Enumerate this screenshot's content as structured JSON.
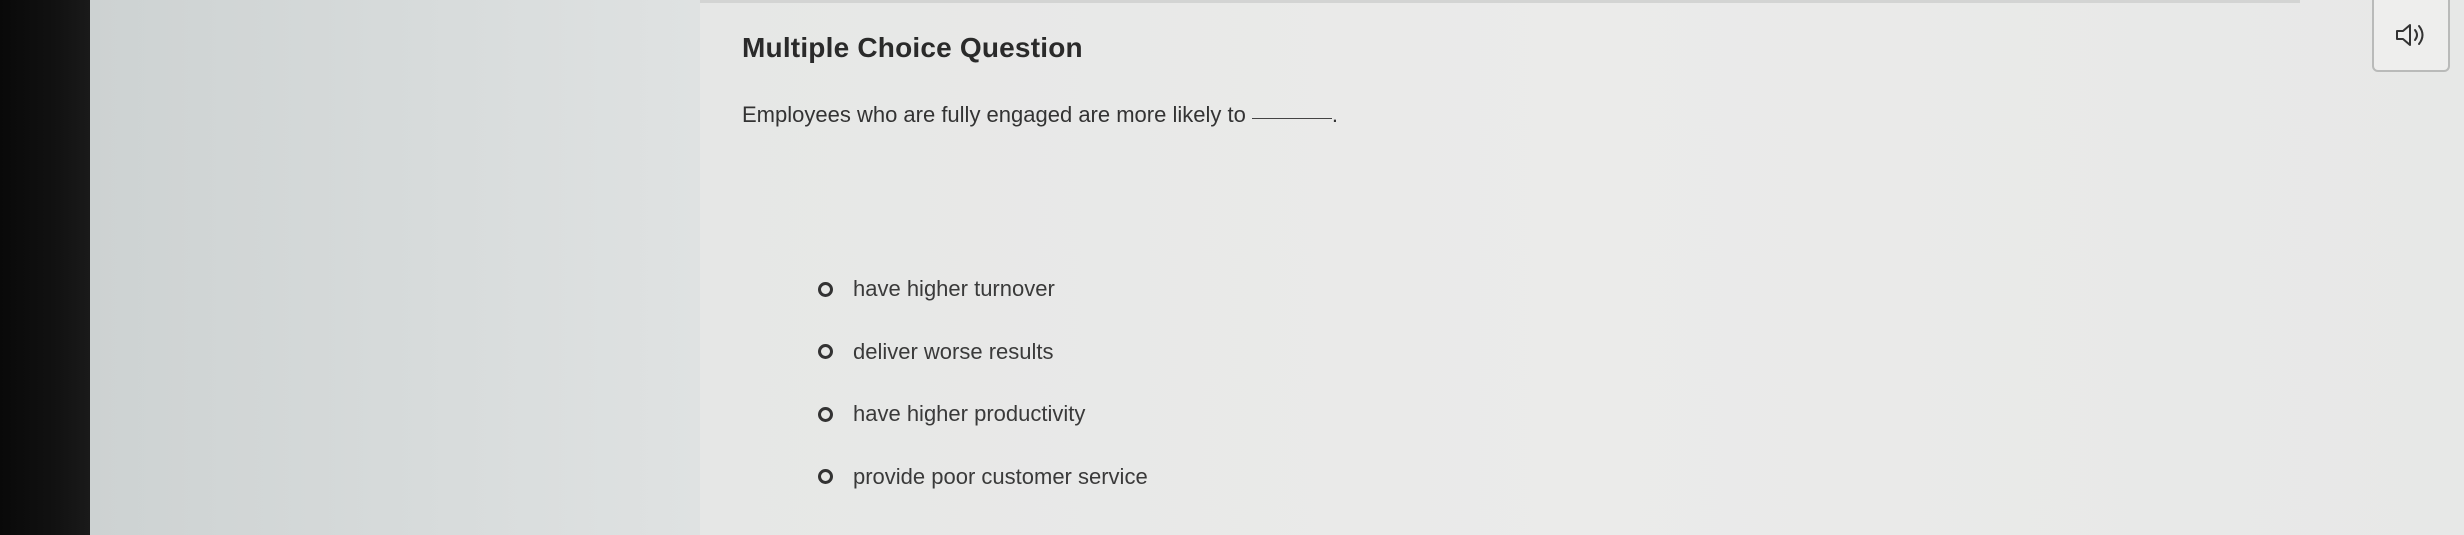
{
  "question": {
    "title": "Multiple Choice Question",
    "prompt": "Employees who are fully engaged are more likely to",
    "prompt_suffix": "."
  },
  "options": [
    {
      "label": "have higher turnover"
    },
    {
      "label": "deliver worse results"
    },
    {
      "label": "have higher productivity"
    },
    {
      "label": "provide poor customer service"
    }
  ],
  "toolbar": {
    "audio_icon": "speaker-icon"
  },
  "colors": {
    "text": "#2a2a2a",
    "background": "#ebebea",
    "side_panel": "#d8dcdc",
    "bezel": "#111111"
  }
}
